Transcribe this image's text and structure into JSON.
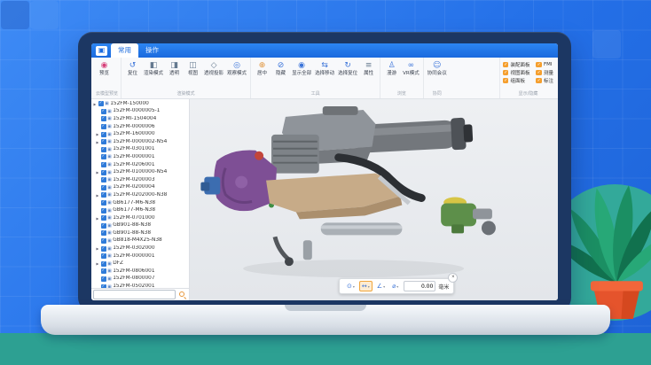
{
  "colors": {
    "backdrop_blue": "#2470e8",
    "titlebar_blue": "#1a6ade",
    "panel_checkbox_orange": "#f59f2e",
    "tree_checkbox_blue": "#2f7bd9",
    "accent_teal": "#2da092",
    "plant_pot_orange": "#e5542c",
    "measure_active_orange": "#f0a63c"
  },
  "app": {
    "menu_tabs": [
      {
        "label": "常用",
        "active": true
      },
      {
        "label": "操作",
        "active": false
      }
    ],
    "ribbon": {
      "groups": [
        {
          "label": "云模型预览",
          "buttons": [
            {
              "label": "预览",
              "icon": "preview-icon",
              "glyph": "◉"
            }
          ]
        },
        {
          "label": "渲染模式",
          "buttons": [
            {
              "label": "复位",
              "icon": "reset-icon",
              "glyph": "↺"
            },
            {
              "label": "渲染模式",
              "icon": "render-mode-icon",
              "glyph": "◧"
            },
            {
              "label": "透明",
              "icon": "transparent-icon",
              "glyph": "◨"
            },
            {
              "label": "视图",
              "icon": "view-icon",
              "glyph": "◫"
            },
            {
              "label": "透视投影",
              "icon": "perspective-icon",
              "glyph": "◇"
            },
            {
              "label": "观察模式",
              "icon": "observe-icon",
              "glyph": "◎"
            }
          ]
        },
        {
          "label": "工具",
          "buttons": [
            {
              "label": "居中",
              "icon": "center-icon",
              "glyph": "⊕"
            },
            {
              "label": "隐藏",
              "icon": "hide-icon",
              "glyph": "⊘"
            },
            {
              "label": "显示全部",
              "icon": "show-all-icon",
              "glyph": "◉"
            },
            {
              "label": "选择移动",
              "icon": "select-move-icon",
              "glyph": "⇆"
            },
            {
              "label": "选择复位",
              "icon": "select-reset-icon",
              "glyph": "↻"
            },
            {
              "label": "属性",
              "icon": "properties-icon",
              "glyph": "≡"
            }
          ]
        },
        {
          "label": "浏览",
          "buttons": [
            {
              "label": "漫游",
              "icon": "walk-icon",
              "glyph": "♙"
            },
            {
              "label": "VR模式",
              "icon": "vr-icon",
              "glyph": "∞"
            }
          ]
        },
        {
          "label": "协同",
          "buttons": [
            {
              "label": "协同会议",
              "icon": "meeting-icon",
              "glyph": "☺"
            }
          ]
        }
      ],
      "display_group": {
        "label": "显示/隐藏",
        "checkboxes": [
          {
            "label": "装配面板",
            "checked": true
          },
          {
            "label": "视图面板",
            "checked": true
          },
          {
            "label": "组面板",
            "checked": true
          },
          {
            "label": "FMI",
            "checked": true
          },
          {
            "label": "测量",
            "checked": true
          },
          {
            "label": "标注",
            "checked": true
          }
        ]
      }
    },
    "model_tree": {
      "items": [
        {
          "label": "152FM-150000",
          "checked": true,
          "arrow": true,
          "level": 0
        },
        {
          "label": "152FM-0000005-1",
          "checked": true,
          "arrow": false,
          "level": 1
        },
        {
          "label": "152FMI-1504004",
          "checked": true,
          "arrow": false,
          "level": 1
        },
        {
          "label": "152FM-0000006",
          "checked": true,
          "arrow": false,
          "level": 1
        },
        {
          "label": "152FM-1600000",
          "checked": true,
          "arrow": true,
          "level": 1
        },
        {
          "label": "152FM-0000002-N54",
          "checked": true,
          "arrow": true,
          "level": 1
        },
        {
          "label": "152FM-0301001",
          "checked": true,
          "arrow": false,
          "level": 1
        },
        {
          "label": "152FM-0000001",
          "checked": true,
          "arrow": false,
          "level": 1
        },
        {
          "label": "152FM-0206001",
          "checked": true,
          "arrow": false,
          "level": 1
        },
        {
          "label": "152FM-0100000-N54",
          "checked": true,
          "arrow": true,
          "level": 1
        },
        {
          "label": "152FM-0200003",
          "checked": true,
          "arrow": false,
          "level": 1
        },
        {
          "label": "152FM-0200004",
          "checked": true,
          "arrow": false,
          "level": 1
        },
        {
          "label": "152FM-0202000-N38",
          "checked": true,
          "arrow": true,
          "level": 1
        },
        {
          "label": "GB6177-M6-N38",
          "checked": true,
          "arrow": false,
          "level": 1
        },
        {
          "label": "GB6177-M6-N38",
          "checked": true,
          "arrow": false,
          "level": 1
        },
        {
          "label": "152FM-0701000",
          "checked": true,
          "arrow": true,
          "level": 1
        },
        {
          "label": "GB901-88-N38",
          "checked": true,
          "arrow": false,
          "level": 1
        },
        {
          "label": "GB901-88-N38",
          "checked": true,
          "arrow": false,
          "level": 1
        },
        {
          "label": "GB818-M4X25-N38",
          "checked": true,
          "arrow": false,
          "level": 1
        },
        {
          "label": "152FM-0302000",
          "checked": true,
          "arrow": true,
          "level": 1
        },
        {
          "label": "152FM-0000001",
          "checked": true,
          "arrow": false,
          "level": 1
        },
        {
          "label": "DFZ",
          "checked": true,
          "arrow": true,
          "level": 1
        },
        {
          "label": "152FM-0806001",
          "checked": true,
          "arrow": false,
          "level": 1
        },
        {
          "label": "152FM-0800007",
          "checked": true,
          "arrow": false,
          "level": 1
        },
        {
          "label": "152FM-0502001",
          "checked": true,
          "arrow": false,
          "level": 1
        }
      ]
    },
    "search": {
      "value": ""
    },
    "measure_bar": {
      "tools": [
        {
          "icon": "measure-point-icon",
          "glyph": "⊙",
          "active": false
        },
        {
          "icon": "measure-distance-icon",
          "glyph": "↔",
          "active": true
        },
        {
          "icon": "measure-angle-icon",
          "glyph": "∠",
          "active": false
        },
        {
          "icon": "measure-radius-icon",
          "glyph": "⌀",
          "active": false
        }
      ],
      "value": "0.00",
      "unit": "毫米"
    }
  }
}
